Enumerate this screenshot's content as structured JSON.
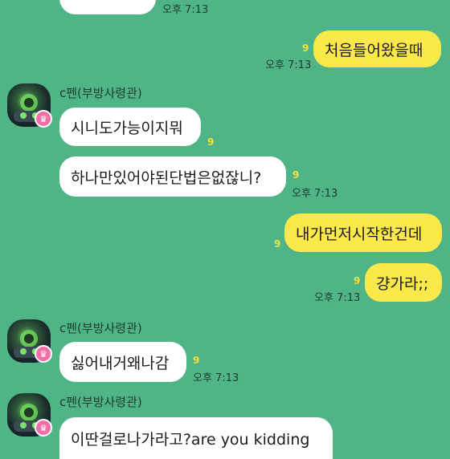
{
  "messages": [
    {
      "text": "",
      "time": "오후 7:13"
    },
    {
      "text": "처음들어왔을때",
      "unread": "9",
      "time": "오후 7:13"
    },
    {
      "sender": "c펜(부방사령관)",
      "text": "시니도가능이지뭐",
      "unread": "9"
    },
    {
      "text": "하나만있어야된단법은없잖니?",
      "unread": "9",
      "time": "오후 7:13"
    },
    {
      "text": "내가먼저시작한건데",
      "unread": "9"
    },
    {
      "text": "걍가라;;",
      "unread": "9",
      "time": "오후 7:13"
    },
    {
      "sender": "c펜(부방사령관)",
      "text": "싫어내거왜나감",
      "unread": "9",
      "time": "오후 7:13"
    },
    {
      "sender": "c펜(부방사령관)",
      "text": "이딴걸로나가라고?are you kidding"
    }
  ],
  "icons": {
    "avatar": "robot-avatar-icon",
    "badge": "crown-icon"
  },
  "colors": {
    "background": "#4fb586",
    "my_bubble": "#fbe94b",
    "their_bubble": "#ffffff",
    "unread": "#f6e23a"
  }
}
